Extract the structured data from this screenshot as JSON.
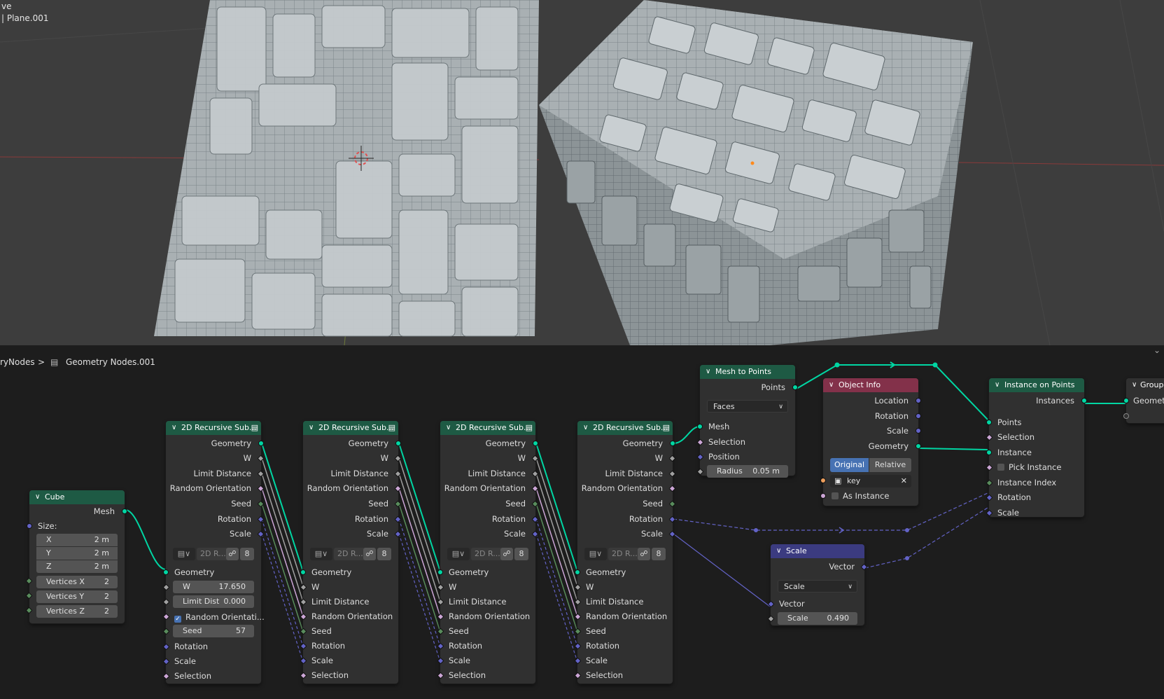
{
  "viewport": {
    "mode_label": "ve",
    "object_label": "| Plane.001"
  },
  "breadcrumb": {
    "tree": "ryNodes",
    "separator": ">",
    "group": "Geometry Nodes.001"
  },
  "nodes": {
    "cube": {
      "title": "Cube",
      "output_mesh": "Mesh",
      "size_label": "Size:",
      "x_label": "X",
      "x_val": "2 m",
      "y_label": "Y",
      "y_val": "2 m",
      "z_label": "Z",
      "z_val": "2 m",
      "vx_label": "Vertices X",
      "vx_val": "2",
      "vy_label": "Vertices Y",
      "vy_val": "2",
      "vz_label": "Vertices Z",
      "vz_val": "2"
    },
    "rec1": {
      "title": "2D Recursive Sub...",
      "outputs": [
        "Geometry",
        "W",
        "Limit Distance",
        "Random Orientation",
        "Seed",
        "Rotation",
        "Scale"
      ],
      "group_name": "2D R...",
      "users": "8",
      "in_geometry": "Geometry",
      "w_label": "W",
      "w_val": "17.650",
      "ld_label": "Limit Dist",
      "ld_val": "0.000",
      "ro_label": "Random Orientati...",
      "seed_label": "Seed",
      "seed_val": "57",
      "in_rotation": "Rotation",
      "in_scale": "Scale",
      "in_selection": "Selection"
    },
    "rec_generic": {
      "title": "2D Recursive Sub...",
      "outputs": [
        "Geometry",
        "W",
        "Limit Distance",
        "Random Orientation",
        "Seed",
        "Rotation",
        "Scale"
      ],
      "group_name": "2D R...",
      "users": "8",
      "inputs": [
        "Geometry",
        "W",
        "Limit Distance",
        "Random Orientation",
        "Seed",
        "Rotation",
        "Scale",
        "Selection"
      ]
    },
    "mesh_to_points": {
      "title": "Mesh to Points",
      "output_points": "Points",
      "mode": "Faces",
      "in_mesh": "Mesh",
      "in_selection": "Selection",
      "in_position": "Position",
      "radius_label": "Radius",
      "radius_val": "0.05 m"
    },
    "object_info": {
      "title": "Object Info",
      "outputs": [
        "Location",
        "Rotation",
        "Scale",
        "Geometry"
      ],
      "original": "Original",
      "relative": "Relative",
      "object": "key",
      "as_instance": "As Instance"
    },
    "instance_on_points": {
      "title": "Instance on Points",
      "output_instances": "Instances",
      "inputs": [
        "Points",
        "Selection",
        "Instance",
        "Pick Instance",
        "Instance Index",
        "Rotation",
        "Scale"
      ]
    },
    "scale": {
      "title": "Scale",
      "output_vector": "Vector",
      "operation": "Scale",
      "in_vector": "Vector",
      "scale_label": "Scale",
      "scale_val": "0.490"
    },
    "group_output": {
      "title": "Group",
      "input": "Geomet"
    }
  },
  "colors": {
    "geometry_socket": "#00d6a3",
    "vector_socket": "#6363c7",
    "float_socket": "#a1a1a1",
    "bool_socket": "#cca6d6",
    "int_socket": "#598c5c",
    "geometry_header": "#1e5a44",
    "input_header": "#83314a",
    "vector_header": "#3b3b80",
    "accent": "#4772b3"
  }
}
